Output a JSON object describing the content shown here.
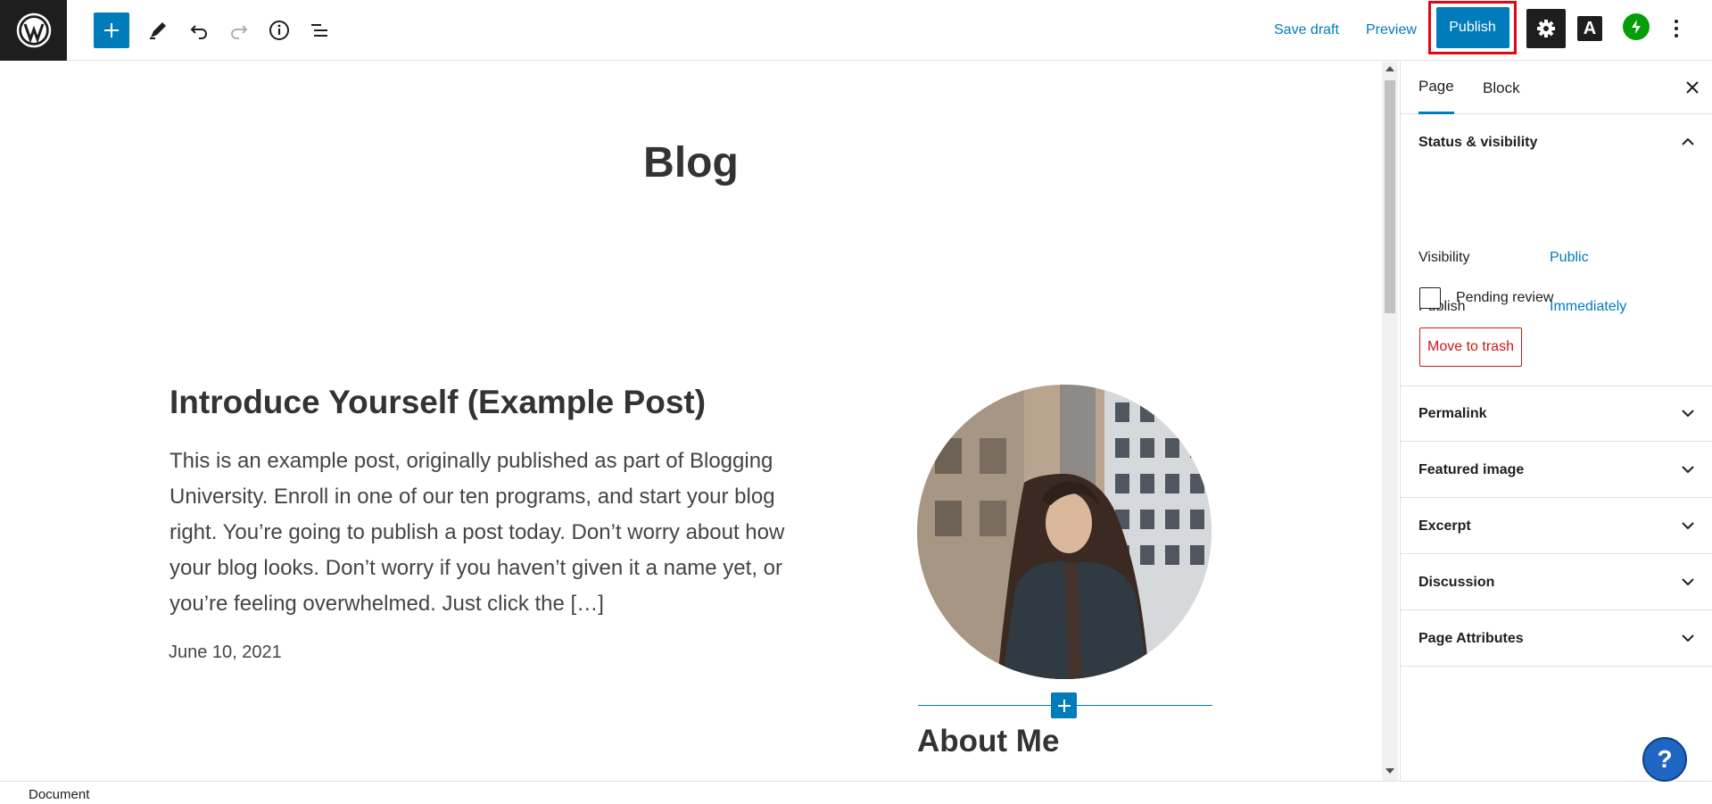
{
  "toolbar": {
    "save_draft": "Save draft",
    "preview": "Preview",
    "publish": "Publish",
    "font_button": "A"
  },
  "editor": {
    "page_title": "Blog",
    "post_title": "Introduce Yourself (Example Post)",
    "post_excerpt": "This is an example post, originally published as part of Blogging University. Enroll in one of our ten programs, and start your blog right. You’re going to publish a post today. Don’t worry about how your blog looks. Don’t worry if you haven’t given it a name yet, or you’re feeling overwhelmed. Just click the […]",
    "post_date": "June 10, 2021",
    "about_heading": "About Me"
  },
  "sidebar": {
    "tabs": [
      {
        "label": "Page",
        "active": true
      },
      {
        "label": "Block",
        "active": false
      }
    ],
    "status_panel": {
      "title": "Status & visibility",
      "visibility_label": "Visibility",
      "visibility_value": "Public",
      "publish_label": "Publish",
      "publish_value": "Immediately",
      "pending_review_label": "Pending review",
      "pending_review_checked": false,
      "trash_label": "Move to trash"
    },
    "panels": [
      {
        "title": "Permalink"
      },
      {
        "title": "Featured image"
      },
      {
        "title": "Excerpt"
      },
      {
        "title": "Discussion"
      },
      {
        "title": "Page Attributes"
      }
    ]
  },
  "footer": {
    "breadcrumb": "Document"
  },
  "colors": {
    "accent": "#007cba",
    "highlight_border": "#e30613",
    "danger": "#cc1818",
    "jetpack": "#069e08"
  },
  "icons": [
    "wordpress-logo-icon",
    "plus-icon",
    "pencil-icon",
    "undo-icon",
    "redo-icon",
    "info-icon",
    "list-view-icon",
    "gear-icon",
    "jetpack-icon",
    "more-vertical-icon",
    "close-icon",
    "chevron-up-icon",
    "chevron-down-icon",
    "help-icon"
  ]
}
